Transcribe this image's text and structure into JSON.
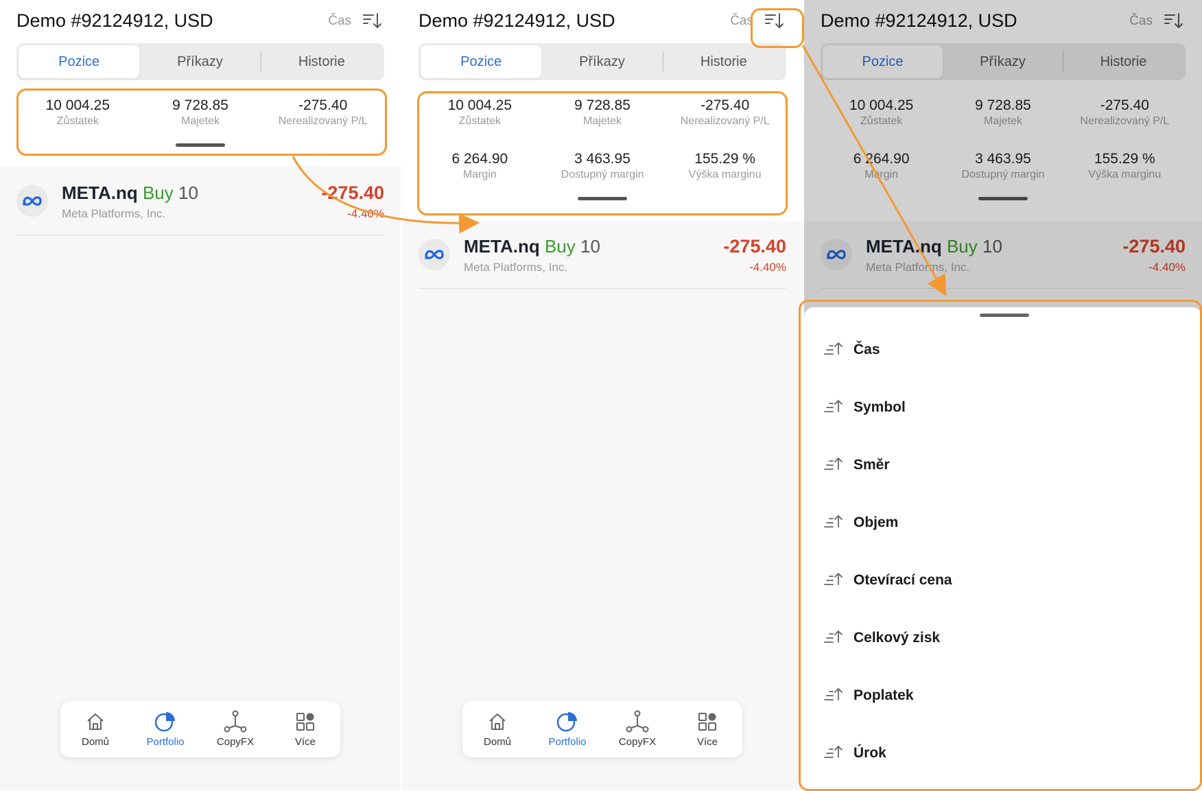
{
  "account": {
    "title": "Demo #92124912, USD",
    "sort_label": "Čas"
  },
  "tabs": [
    {
      "label": "Pozice"
    },
    {
      "label": "Příkazy"
    },
    {
      "label": "Historie"
    }
  ],
  "stats": {
    "balance_value": "10 004.25",
    "balance_label": "Zůstatek",
    "equity_value": "9 728.85",
    "equity_label": "Majetek",
    "upl_value": "-275.40",
    "upl_label": "Nerealizovaný P/L",
    "margin_value": "6 264.90",
    "margin_label": "Margin",
    "free_margin_value": "3 463.95",
    "free_margin_label": "Dostupný margin",
    "margin_level_value": "155.29 %",
    "margin_level_label": "Výška marginu"
  },
  "position": {
    "symbol": "META.nq",
    "side": "Buy",
    "volume": "10",
    "company": "Meta Platforms, Inc.",
    "pl": "-275.40",
    "pl_pct": "-4.40%"
  },
  "nav": [
    {
      "label": "Domů",
      "icon": "home-icon"
    },
    {
      "label": "Portfolio",
      "icon": "portfolio-icon"
    },
    {
      "label": "CopyFX",
      "icon": "copyfx-icon"
    },
    {
      "label": "Více",
      "icon": "more-icon"
    }
  ],
  "sort_options": [
    {
      "label": "Čas"
    },
    {
      "label": "Symbol"
    },
    {
      "label": "Směr"
    },
    {
      "label": "Objem"
    },
    {
      "label": "Otevírací cena"
    },
    {
      "label": "Celkový zisk"
    },
    {
      "label": "Poplatek"
    },
    {
      "label": "Úrok"
    }
  ],
  "colors": {
    "accent": "#2a6fd6",
    "positive": "#3a9b2e",
    "negative": "#d3432a",
    "highlight": "#f39a32",
    "background": "#f7f7f7"
  }
}
